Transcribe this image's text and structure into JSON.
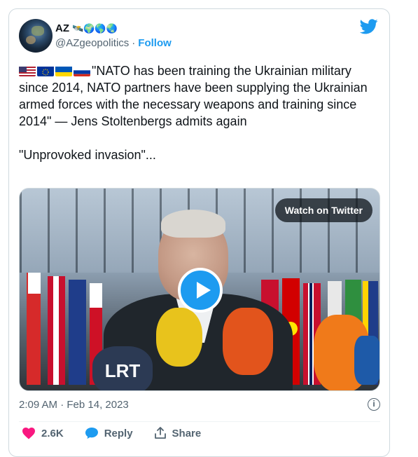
{
  "author": {
    "display_name": "AZ",
    "emoji": "🛰️🌍🌎🌏",
    "handle": "@AZgeopolitics",
    "separator": "·",
    "follow_label": "Follow"
  },
  "tweet": {
    "flags_alt": "US EU Ukraine Russia flags",
    "line1": "\"NATO has been training the Ukrainian military since 2014, NATO partners have been supplying the Ukrainian armed forces with the necessary weapons and training since 2014\" — Jens Stoltenbergs admits again",
    "line2": "\"Unprovoked invasion\"..."
  },
  "media": {
    "watch_label": "Watch on Twitter",
    "mic_lrt": "LRT"
  },
  "meta": {
    "timestamp": "2:09 AM · Feb 14, 2023",
    "info_glyph": "i"
  },
  "actions": {
    "likes": "2.6K",
    "reply_label": "Reply",
    "share_label": "Share"
  },
  "colors": {
    "accent": "#1d9bf0",
    "like": "#f91880",
    "muted": "#536471"
  },
  "icons": [
    "twitter-logo-icon",
    "heart-icon",
    "reply-bubble-icon",
    "share-icon",
    "info-icon",
    "play-icon"
  ]
}
